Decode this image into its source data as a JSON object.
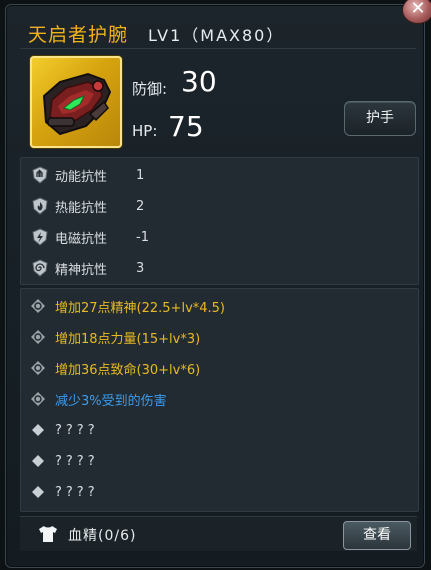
{
  "header": {
    "close_glyph": "✕",
    "title": "天启者护腕",
    "level": "LV1（MAX80）"
  },
  "item": {
    "icon": "bracer-icon",
    "frame_color": "#e0ae14",
    "defense_label": "防御:",
    "defense_value": "30",
    "hp_label": "HP:",
    "hp_value": "75",
    "type_label": "护手"
  },
  "resistances": [
    {
      "icon": "kinetic-icon",
      "label": "动能抗性",
      "value": "1"
    },
    {
      "icon": "fire-icon",
      "label": "热能抗性",
      "value": "2"
    },
    {
      "icon": "lightning-icon",
      "label": "电磁抗性",
      "value": "-1"
    },
    {
      "icon": "spiral-icon",
      "label": "精神抗性",
      "value": "3"
    }
  ],
  "bonuses": [
    {
      "text": "增加27点精神(22.5+lv*4.5)",
      "color": "#e8b923",
      "locked": false
    },
    {
      "text": "增加18点力量(15+lv*3)",
      "color": "#e8b923",
      "locked": false
    },
    {
      "text": "增加36点致命(30+lv*6)",
      "color": "#e8b923",
      "locked": false
    },
    {
      "text": "减少3%受到的伤害",
      "color": "#3a9cf0",
      "locked": false
    },
    {
      "text": "????",
      "color": "#d9dee2",
      "locked": true
    },
    {
      "text": "????",
      "color": "#d9dee2",
      "locked": true
    },
    {
      "text": "????",
      "color": "#d9dee2",
      "locked": true
    }
  ],
  "footer": {
    "icon": "shirt-icon",
    "label": "血精(0/6)",
    "view_button": "查看"
  }
}
